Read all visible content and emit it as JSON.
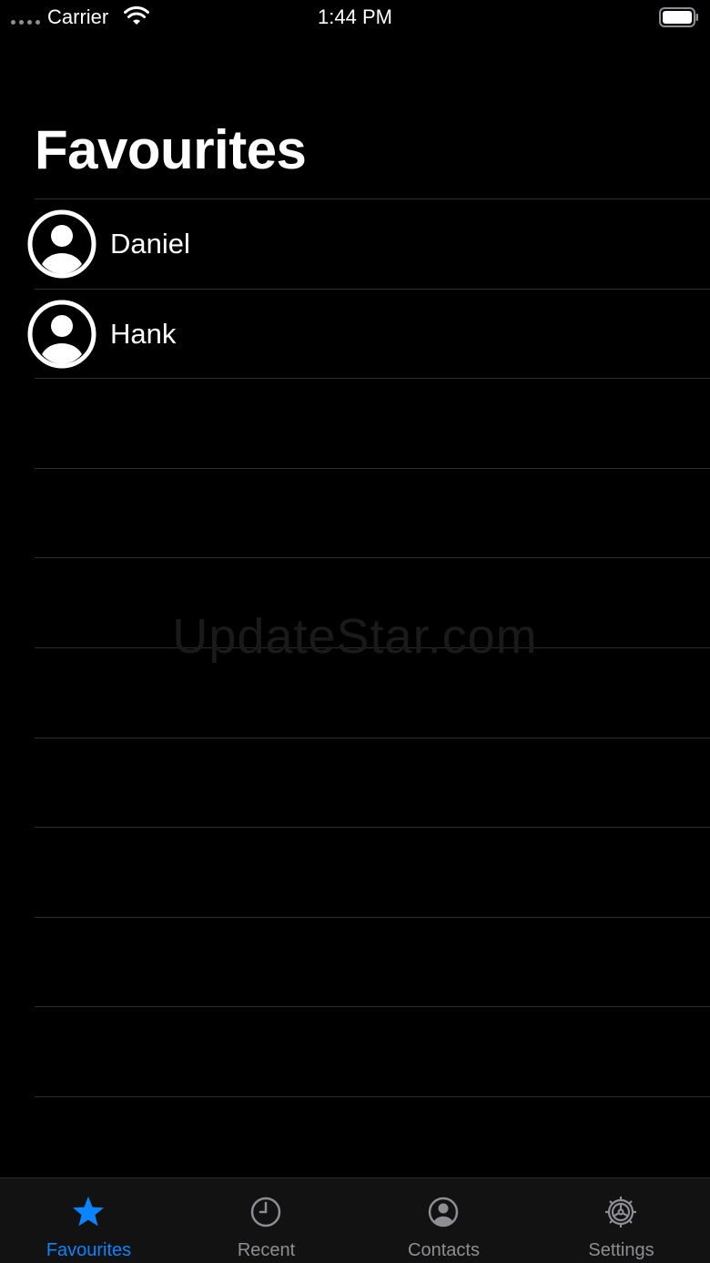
{
  "status_bar": {
    "carrier": "Carrier",
    "time": "1:44 PM"
  },
  "page": {
    "title": "Favourites"
  },
  "favourites": [
    {
      "name": "Daniel"
    },
    {
      "name": "Hank"
    }
  ],
  "watermark": "UpdateStar.com",
  "tabs": [
    {
      "label": "Favourites",
      "icon": "star-icon",
      "active": true
    },
    {
      "label": "Recent",
      "icon": "clock-icon",
      "active": false
    },
    {
      "label": "Contacts",
      "icon": "person-circle-icon",
      "active": false
    },
    {
      "label": "Settings",
      "icon": "gear-icon",
      "active": false
    }
  ],
  "colors": {
    "accent": "#0a84ff",
    "inactive": "#8e8e93",
    "background": "#000000",
    "separator": "#2c2c2e"
  }
}
